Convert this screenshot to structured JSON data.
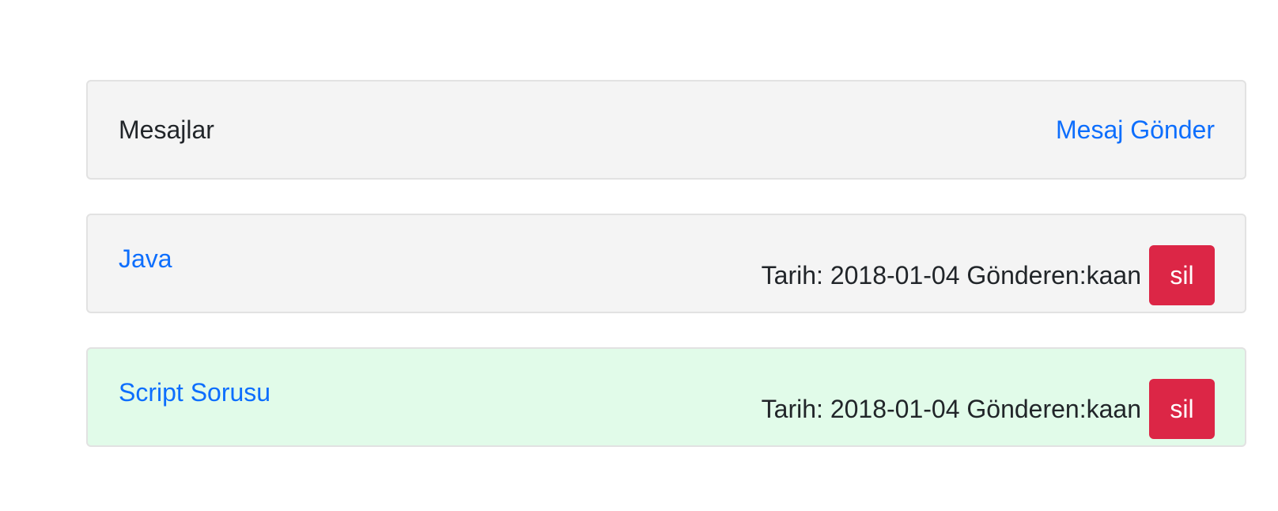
{
  "header": {
    "title": "Mesajlar",
    "send_link": "Mesaj Gönder"
  },
  "messages": [
    {
      "subject": "Java",
      "meta": "Tarih: 2018-01-04 Gönderen:kaan",
      "delete_label": "sil",
      "highlighted": false
    },
    {
      "subject": "Script Sorusu",
      "meta": "Tarih: 2018-01-04 Gönderen:kaan",
      "delete_label": "sil",
      "highlighted": true
    }
  ],
  "colors": {
    "link": "#0d6efd",
    "danger": "#dc2646",
    "card_bg": "#f4f4f4",
    "highlight_bg": "#e1fbe9"
  }
}
